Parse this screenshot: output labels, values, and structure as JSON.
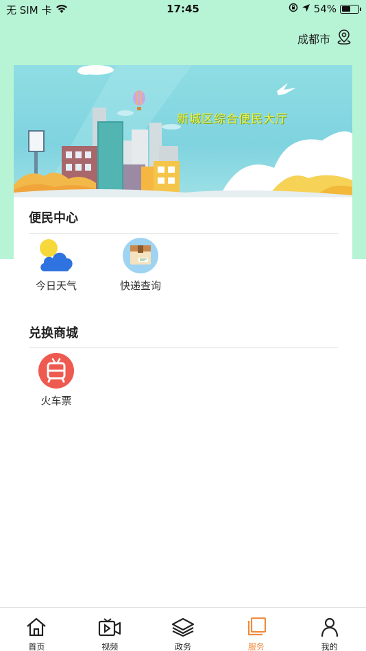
{
  "status_bar": {
    "carrier": "无 SIM 卡",
    "time": "17:45",
    "battery": "54%",
    "battery_level": 0.54
  },
  "location": {
    "city": "成都市",
    "icon": "location-pin-icon"
  },
  "banner": {
    "title": "新城区综合便民大厅"
  },
  "sections": {
    "convenience": {
      "title": "便民中心",
      "items": [
        {
          "label": "今日天气",
          "icon": "weather-cloud-icon"
        },
        {
          "label": "快递查询",
          "icon": "package-icon"
        }
      ]
    },
    "exchange": {
      "title": "兑换商城",
      "items": [
        {
          "label": "火车票",
          "icon": "train-icon"
        }
      ]
    }
  },
  "tabbar": {
    "active_color": "#f08a3c",
    "items": [
      {
        "label": "首页",
        "icon": "home-icon"
      },
      {
        "label": "视频",
        "icon": "video-icon"
      },
      {
        "label": "政务",
        "icon": "layers-icon"
      },
      {
        "label": "服务",
        "icon": "service-icon"
      },
      {
        "label": "我的",
        "icon": "user-icon"
      }
    ]
  }
}
